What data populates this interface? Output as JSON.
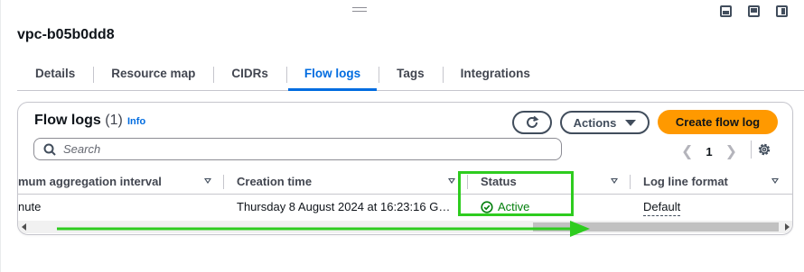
{
  "panel": {
    "resource_title": "vpc-b05b0dd8"
  },
  "layout_icons": [
    {
      "name": "bottom-panel-icon"
    },
    {
      "name": "split-panel-icon"
    },
    {
      "name": "side-panel-icon"
    }
  ],
  "tabs": [
    {
      "label": "Details",
      "active": false
    },
    {
      "label": "Resource map",
      "active": false
    },
    {
      "label": "CIDRs",
      "active": false
    },
    {
      "label": "Flow logs",
      "active": true
    },
    {
      "label": "Tags",
      "active": false
    },
    {
      "label": "Integrations",
      "active": false
    }
  ],
  "flow_logs": {
    "title": "Flow logs",
    "count": "(1)",
    "info_label": "Info",
    "actions_label": "Actions",
    "create_label": "Create flow log",
    "search_placeholder": "Search",
    "page_number": "1",
    "columns": [
      "mum aggregation interval",
      "Creation time",
      "Status",
      "Log line format"
    ],
    "rows": [
      {
        "aggregation_interval": "nute",
        "creation_time": "Thursday 8 August 2024 at 16:23:16 G…",
        "status": "Active",
        "log_line_format": "Default"
      }
    ]
  },
  "colors": {
    "accent": "#006ce0",
    "primary_button": "#ff9900",
    "status_success": "#037f0c",
    "annotation_green": "#2ecc1f"
  }
}
